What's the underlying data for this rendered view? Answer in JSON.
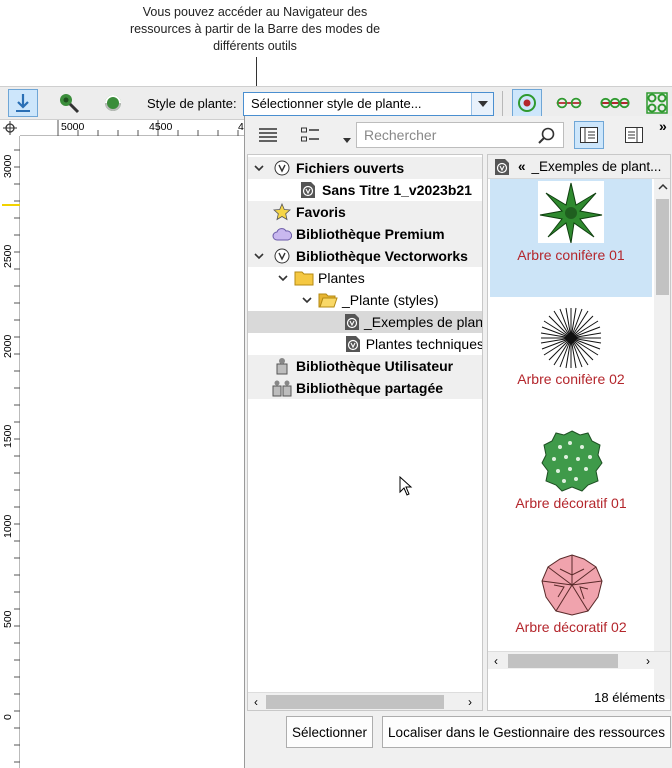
{
  "callout": {
    "lines": [
      "Vous pouvez accéder au Navigateur des",
      "ressources à partir de la Barre des modes de",
      "différents outils"
    ]
  },
  "toolbar": {
    "plant_style_label": "Style de plante:",
    "plant_style_value": "Sélectionner style de plante...",
    "mode_icons": [
      "placement-mode-icon",
      "pick-up-mode-icon",
      "sync-mode-icon",
      "single-plant-icon",
      "line-plants-icon",
      "pole-plants-icon",
      "grid-plants-icon"
    ]
  },
  "rulers": {
    "top": [
      "5000",
      "4500",
      "4"
    ],
    "left": [
      "3000",
      "2500",
      "2000",
      "1500",
      "1000",
      "500",
      "0"
    ]
  },
  "browser": {
    "search_placeholder": "Rechercher",
    "tree": [
      {
        "label": "Fichiers ouverts",
        "kind": "header",
        "chevron": "down",
        "icon": "vectorworks-icon"
      },
      {
        "label": "Sans Titre 1_v2023b21",
        "kind": "file",
        "icon": "vw-file-icon"
      },
      {
        "label": "Favoris",
        "kind": "header",
        "icon": "star-icon"
      },
      {
        "label": "Bibliothèque Premium",
        "kind": "header",
        "icon": "cloud-icon"
      },
      {
        "label": "Bibliothèque Vectorworks",
        "kind": "header",
        "chevron": "down",
        "icon": "vectorworks-icon"
      },
      {
        "label": "Plantes",
        "kind": "folder",
        "chevron": "down",
        "icon": "folder-icon"
      },
      {
        "label": "_Plante (styles)",
        "kind": "folder",
        "chevron": "down",
        "icon": "folder-open-icon"
      },
      {
        "label": "_Exemples de plantes",
        "kind": "file",
        "selected": true,
        "icon": "vw-file-icon"
      },
      {
        "label": "Plantes techniques",
        "kind": "file",
        "icon": "vw-file-icon"
      },
      {
        "label": "Bibliothèque Utilisateur",
        "kind": "header",
        "icon": "user-library-icon"
      },
      {
        "label": "Bibliothèque partagée",
        "kind": "header",
        "icon": "shared-library-icon"
      }
    ],
    "gallery_header_chevron": "«",
    "gallery_header": "_Exemples de plant...",
    "gallery": [
      {
        "label": "Arbre conifère 01",
        "selected": true,
        "icon": "conifer-tree-green-icon"
      },
      {
        "label": "Arbre conifère 02",
        "icon": "conifer-tree-starburst-icon"
      },
      {
        "label": "Arbre décoratif 01",
        "icon": "decorative-tree-green-icon"
      },
      {
        "label": "Arbre décoratif 02",
        "icon": "decorative-tree-pink-icon"
      }
    ],
    "count": "18 éléments",
    "select_button": "Sélectionner",
    "locate_button": "Localiser dans le Gestionnaire des ressources"
  },
  "colors": {
    "label_red": "#b4262c",
    "selection_blue": "#cce4f7",
    "accent_green": "#2f9a2f",
    "ruler_yellow": "#f2d200"
  }
}
